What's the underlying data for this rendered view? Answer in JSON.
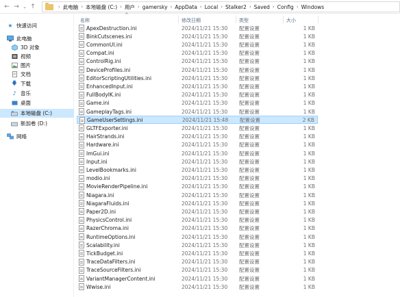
{
  "address_bar": {
    "crumbs": [
      "此电脑",
      "本地磁盘 (C:)",
      "用户",
      "gamersky",
      "AppData",
      "Local",
      "Stalker2",
      "Saved",
      "Config",
      "Windows"
    ]
  },
  "sidebar": {
    "items": [
      {
        "label": "快速访问",
        "icon": "star-icon"
      },
      {
        "label": "此电脑",
        "icon": "computer-icon"
      },
      {
        "label": "3D 对象",
        "icon": "cube-icon"
      },
      {
        "label": "视频",
        "icon": "video-icon"
      },
      {
        "label": "图片",
        "icon": "picture-icon"
      },
      {
        "label": "文档",
        "icon": "document-icon"
      },
      {
        "label": "下载",
        "icon": "download-icon"
      },
      {
        "label": "音乐",
        "icon": "music-icon"
      },
      {
        "label": "桌面",
        "icon": "desktop-icon"
      },
      {
        "label": "本地磁盘 (C:)",
        "icon": "drive-icon"
      },
      {
        "label": "新加卷 (D:)",
        "icon": "drive-icon"
      },
      {
        "label": "网络",
        "icon": "network-icon"
      }
    ]
  },
  "columns": {
    "name": "名称",
    "date": "修改日期",
    "type": "类型",
    "size": "大小"
  },
  "files": [
    {
      "name": "ApexDestruction.ini",
      "date": "2024/11/21 15:30",
      "type": "配置设置",
      "size": "1 KB"
    },
    {
      "name": "BinkCutscenes.ini",
      "date": "2024/11/21 15:30",
      "type": "配置设置",
      "size": "1 KB"
    },
    {
      "name": "CommonUI.ini",
      "date": "2024/11/21 15:30",
      "type": "配置设置",
      "size": "1 KB"
    },
    {
      "name": "Compat.ini",
      "date": "2024/11/21 15:30",
      "type": "配置设置",
      "size": "1 KB"
    },
    {
      "name": "ControlRig.ini",
      "date": "2024/11/21 15:30",
      "type": "配置设置",
      "size": "1 KB"
    },
    {
      "name": "DeviceProfiles.ini",
      "date": "2024/11/21 15:30",
      "type": "配置设置",
      "size": "1 KB"
    },
    {
      "name": "EditorScriptingUtilities.ini",
      "date": "2024/11/21 15:30",
      "type": "配置设置",
      "size": "1 KB"
    },
    {
      "name": "EnhancedInput.ini",
      "date": "2024/11/21 15:30",
      "type": "配置设置",
      "size": "1 KB"
    },
    {
      "name": "FullBodyIK.ini",
      "date": "2024/11/21 15:30",
      "type": "配置设置",
      "size": "1 KB"
    },
    {
      "name": "Game.ini",
      "date": "2024/11/21 15:30",
      "type": "配置设置",
      "size": "1 KB"
    },
    {
      "name": "GameplayTags.ini",
      "date": "2024/11/21 15:30",
      "type": "配置设置",
      "size": "1 KB"
    },
    {
      "name": "GameUserSettings.ini",
      "date": "2024/11/21 15:48",
      "type": "配置设置",
      "size": "2 KB",
      "selected": true
    },
    {
      "name": "GLTFExporter.ini",
      "date": "2024/11/21 15:30",
      "type": "配置设置",
      "size": "1 KB"
    },
    {
      "name": "HairStrands.ini",
      "date": "2024/11/21 15:30",
      "type": "配置设置",
      "size": "1 KB"
    },
    {
      "name": "Hardware.ini",
      "date": "2024/11/21 15:30",
      "type": "配置设置",
      "size": "1 KB"
    },
    {
      "name": "ImGui.ini",
      "date": "2024/11/21 15:30",
      "type": "配置设置",
      "size": "1 KB"
    },
    {
      "name": "Input.ini",
      "date": "2024/11/21 15:30",
      "type": "配置设置",
      "size": "1 KB"
    },
    {
      "name": "LevelBookmarks.ini",
      "date": "2024/11/21 15:30",
      "type": "配置设置",
      "size": "1 KB"
    },
    {
      "name": "modio.ini",
      "date": "2024/11/21 15:30",
      "type": "配置设置",
      "size": "1 KB"
    },
    {
      "name": "MovieRenderPipeline.ini",
      "date": "2024/11/21 15:30",
      "type": "配置设置",
      "size": "1 KB"
    },
    {
      "name": "Niagara.ini",
      "date": "2024/11/21 15:30",
      "type": "配置设置",
      "size": "1 KB"
    },
    {
      "name": "NiagaraFluids.ini",
      "date": "2024/11/21 15:30",
      "type": "配置设置",
      "size": "1 KB"
    },
    {
      "name": "Paper2D.ini",
      "date": "2024/11/21 15:30",
      "type": "配置设置",
      "size": "1 KB"
    },
    {
      "name": "PhysicsControl.ini",
      "date": "2024/11/21 15:30",
      "type": "配置设置",
      "size": "1 KB"
    },
    {
      "name": "RazerChroma.ini",
      "date": "2024/11/21 15:30",
      "type": "配置设置",
      "size": "1 KB"
    },
    {
      "name": "RuntimeOptions.ini",
      "date": "2024/11/21 15:30",
      "type": "配置设置",
      "size": "1 KB"
    },
    {
      "name": "Scalability.ini",
      "date": "2024/11/21 15:30",
      "type": "配置设置",
      "size": "1 KB"
    },
    {
      "name": "TickBudget.ini",
      "date": "2024/11/21 15:30",
      "type": "配置设置",
      "size": "1 KB"
    },
    {
      "name": "TraceDataFilters.ini",
      "date": "2024/11/21 15:30",
      "type": "配置设置",
      "size": "1 KB"
    },
    {
      "name": "TraceSourceFilters.ini",
      "date": "2024/11/21 15:30",
      "type": "配置设置",
      "size": "1 KB"
    },
    {
      "name": "VariantManagerContent.ini",
      "date": "2024/11/21 15:30",
      "type": "配置设置",
      "size": "1 KB"
    },
    {
      "name": "Wwise.ini",
      "date": "2024/11/21 15:30",
      "type": "配置设置",
      "size": "1 KB"
    }
  ]
}
